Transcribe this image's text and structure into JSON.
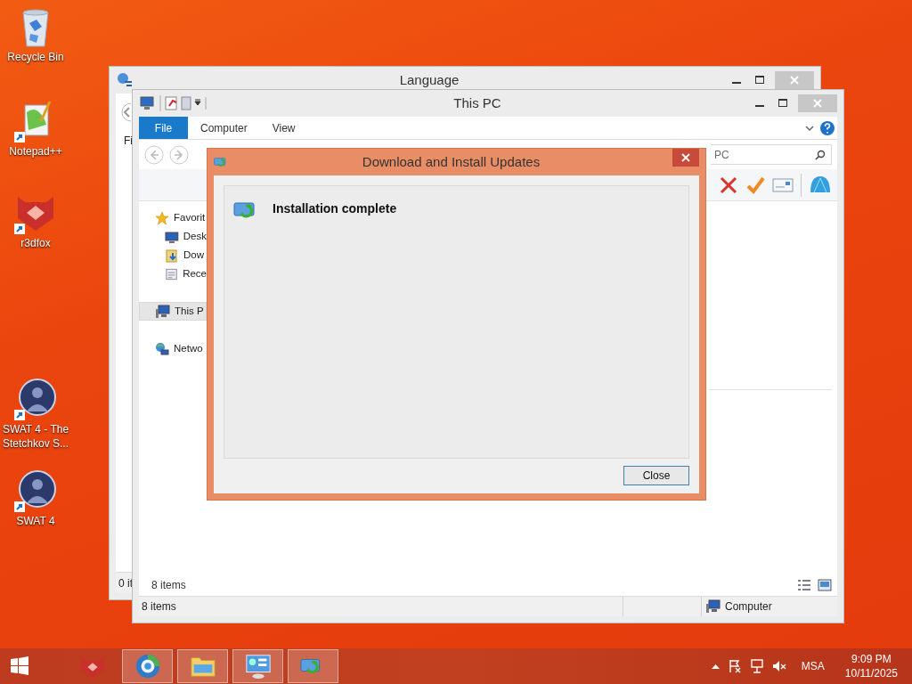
{
  "desktop_icons": [
    {
      "kind": "recycle",
      "label": "Recycle Bin"
    },
    {
      "kind": "notepad",
      "label": "Notepad++"
    },
    {
      "kind": "fox",
      "label": "r3dfox"
    },
    {
      "kind": "game",
      "label": "SWAT 4 - The Stetchkov S..."
    },
    {
      "kind": "game",
      "label": "SWAT 4"
    }
  ],
  "language_window": {
    "title": "Language",
    "menu_partial": "Fi",
    "status_partial": "0 it"
  },
  "explorer": {
    "title": "This PC",
    "tabs": [
      {
        "label": "File",
        "selected": true
      },
      {
        "label": "Computer",
        "selected": false
      },
      {
        "label": "View",
        "selected": false
      }
    ],
    "search": {
      "placeholder": "PC"
    },
    "nav": [
      {
        "label": "Favorit",
        "kind": "star",
        "selected": false,
        "children": [
          {
            "label": "Desk",
            "kind": "desktop",
            "selected": false
          },
          {
            "label": "Dow",
            "kind": "downloads",
            "selected": false
          },
          {
            "label": "Rece",
            "kind": "recent",
            "selected": false
          }
        ]
      },
      {
        "label": "This P",
        "kind": "pc",
        "selected": true
      },
      {
        "label": "Netwo",
        "kind": "network",
        "selected": false
      }
    ],
    "content_status": "8 items",
    "status_bar": {
      "count": "8 items",
      "location": "Computer"
    }
  },
  "dialog": {
    "title": "Download and Install Updates",
    "message": "Installation complete",
    "buttons": [
      "Close"
    ]
  },
  "taskbar": {
    "apps": [
      {
        "kind": "fox",
        "running": false
      },
      {
        "kind": "browser",
        "running": true
      },
      {
        "kind": "folder",
        "running": true
      },
      {
        "kind": "control-panel",
        "running": true
      },
      {
        "kind": "updates",
        "running": true
      }
    ],
    "tray": {
      "language": "MSA",
      "time": "9:09 PM",
      "date": "10/11/2025"
    }
  }
}
